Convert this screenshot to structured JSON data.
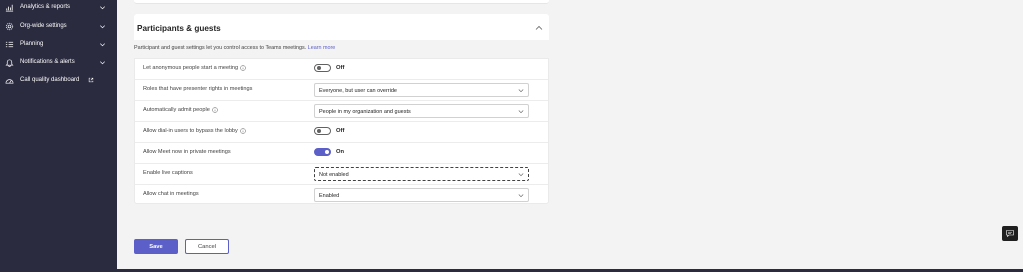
{
  "sidebar": {
    "items": [
      {
        "label": "Analytics & reports",
        "icon": "analytics-icon",
        "expandable": true
      },
      {
        "label": "Org-wide settings",
        "icon": "gear-icon",
        "expandable": true
      },
      {
        "label": "Planning",
        "icon": "planning-list-icon",
        "expandable": true
      },
      {
        "label": "Notifications & alerts",
        "icon": "bell-icon",
        "expandable": true
      },
      {
        "label": "Call quality dashboard",
        "icon": "dashboard-icon",
        "external": true
      }
    ]
  },
  "section": {
    "title": "Participants & guests",
    "description": "Participant and guest settings let you control access to Teams meetings.",
    "learn_more": "Learn more"
  },
  "settings": [
    {
      "label": "Let anonymous people start a meeting",
      "info": true,
      "type": "toggle",
      "state": "Off"
    },
    {
      "label": "Roles that have presenter rights in meetings",
      "info": false,
      "type": "dropdown",
      "value": "Everyone, but user can override"
    },
    {
      "label": "Automatically admit people",
      "info": true,
      "type": "dropdown",
      "value": "People in my organization and guests"
    },
    {
      "label": "Allow dial-in users to bypass the lobby",
      "info": true,
      "type": "toggle",
      "state": "Off"
    },
    {
      "label": "Allow Meet now in private meetings",
      "info": false,
      "type": "toggle",
      "state": "On"
    },
    {
      "label": "Enable live captions",
      "info": false,
      "type": "dropdown",
      "value": "Not enabled"
    },
    {
      "label": "Allow chat in meetings",
      "info": false,
      "type": "dropdown",
      "value": "Enabled"
    }
  ],
  "actions": {
    "save": "Save",
    "cancel": "Cancel"
  },
  "colors": {
    "accent": "#5b5fc7",
    "sidebar_bg": "#2b2b40",
    "page_bg": "#f3f3f3"
  }
}
